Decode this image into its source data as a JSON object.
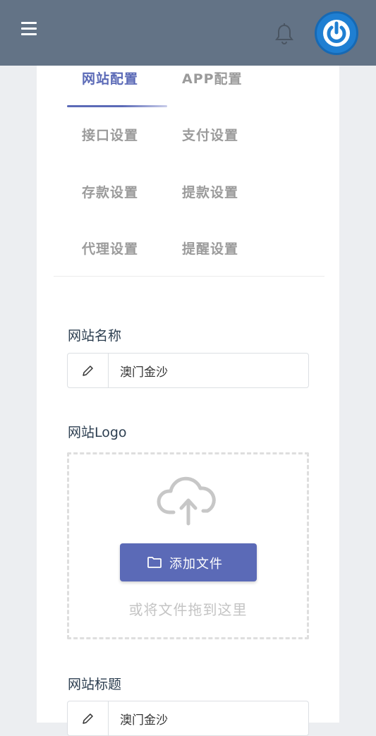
{
  "header": {
    "menu_icon": "hamburger-menu-icon",
    "bell_icon": "bell-icon",
    "avatar_icon": "power-icon",
    "bar_color": "#637386",
    "avatar_color": "#1f7fd2"
  },
  "tabs": [
    {
      "label": "网站配置",
      "active": true
    },
    {
      "label": "APP配置",
      "active": false
    },
    {
      "label": "接口设置",
      "active": false
    },
    {
      "label": "支付设置",
      "active": false
    },
    {
      "label": "存款设置",
      "active": false
    },
    {
      "label": "提款设置",
      "active": false
    },
    {
      "label": "代理设置",
      "active": false
    },
    {
      "label": "提醒设置",
      "active": false
    }
  ],
  "form": {
    "site_name": {
      "label": "网站名称",
      "value": "澳门金沙",
      "icon": "pencil-icon"
    },
    "site_logo": {
      "label": "网站Logo",
      "upload_icon": "cloud-upload-icon",
      "button_icon": "folder-icon",
      "button_label": "添加文件",
      "hint": "或将文件拖到这里"
    },
    "site_title": {
      "label": "网站标题",
      "value": "澳门金沙",
      "icon": "pencil-icon"
    }
  },
  "colors": {
    "accent": "#5b6ab7",
    "inactive_tab": "#9b9b9b",
    "label_text": "#2c3e50"
  }
}
